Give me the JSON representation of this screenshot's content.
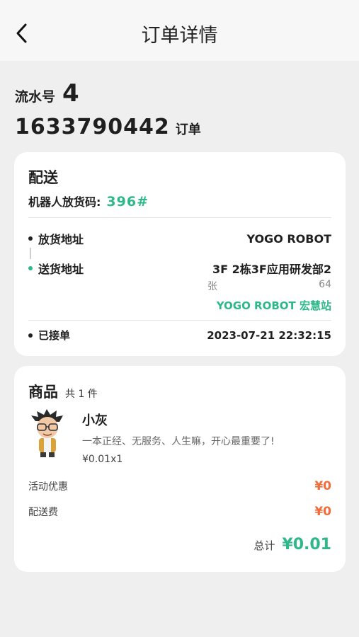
{
  "header": {
    "title": "订单详情"
  },
  "order": {
    "serial_label": "流水号",
    "serial_value": "4",
    "order_number": "1633790442",
    "order_label": "订单"
  },
  "delivery": {
    "title": "配送",
    "pickup_label": "机器人放货码:",
    "pickup_code": "396#",
    "from_label": "放货地址",
    "from_value": "YOGO ROBOT",
    "to_label": "送货地址",
    "to_value": "3F 2栋3F应用研发部2",
    "recipient_name": "张",
    "recipient_phone": "64",
    "station": "YOGO ROBOT 宏慧站",
    "status_label": "已接单",
    "status_time": "2023-07-21 22:32:15"
  },
  "goods": {
    "title": "商品",
    "count": "共 1 件",
    "item": {
      "name": "小灰",
      "desc": "一本正经、无服务、人生嘛，开心最重要了!",
      "price": "¥0.01x1"
    },
    "discount_label": "活动优惠",
    "discount_value": "¥0",
    "fee_label": "配送费",
    "fee_value": "¥0",
    "total_label": "总计",
    "total_value": "¥0.01"
  },
  "colors": {
    "accent": "#2eb88a",
    "price": "#f26b3a"
  }
}
